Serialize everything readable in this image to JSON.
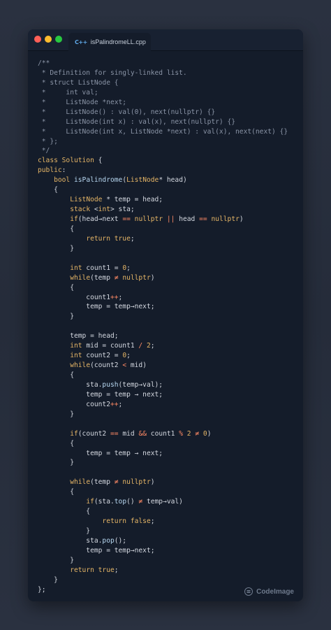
{
  "window": {
    "tab_icon": "C++",
    "tab_label": "isPalindromeLL.cpp"
  },
  "watermark": {
    "label": "CodeImage"
  },
  "colors": {
    "comment": "#8a94a6",
    "keyword": "#e5b566",
    "function": "#b7d7f0",
    "text": "#d4d8e0",
    "operator": "#ff8a65"
  },
  "code_lines": [
    [
      [
        "cm",
        "/**"
      ]
    ],
    [
      [
        "cm",
        " * Definition for singly-linked list."
      ]
    ],
    [
      [
        "cm",
        " * struct ListNode {"
      ]
    ],
    [
      [
        "cm",
        " *     int val;"
      ]
    ],
    [
      [
        "cm",
        " *     ListNode *next;"
      ]
    ],
    [
      [
        "cm",
        " *     ListNode() : val(0), next(nullptr) {}"
      ]
    ],
    [
      [
        "cm",
        " *     ListNode(int x) : val(x), next(nullptr) {}"
      ]
    ],
    [
      [
        "cm",
        " *     ListNode(int x, ListNode *next) : val(x), next(next) {}"
      ]
    ],
    [
      [
        "cm",
        " * };"
      ]
    ],
    [
      [
        "cm",
        " */"
      ]
    ],
    [
      [
        "kw",
        "class "
      ],
      [
        "ty",
        "Solution"
      ],
      [
        "tx",
        " {"
      ]
    ],
    [
      [
        "kw",
        "public"
      ],
      [
        "tx",
        ":"
      ]
    ],
    [
      [
        "tx",
        "    "
      ],
      [
        "kw",
        "bool "
      ],
      [
        "fn",
        "isPalindrome"
      ],
      [
        "tx",
        "("
      ],
      [
        "ty",
        "ListNode"
      ],
      [
        "tx",
        "* head)"
      ]
    ],
    [
      [
        "tx",
        "    {"
      ]
    ],
    [
      [
        "tx",
        "        "
      ],
      [
        "ty",
        "ListNode"
      ],
      [
        "tx",
        " * temp = head;"
      ]
    ],
    [
      [
        "tx",
        "        "
      ],
      [
        "ty",
        "stack"
      ],
      [
        "tx",
        " <"
      ],
      [
        "kw",
        "int"
      ],
      [
        "tx",
        "> sta;"
      ]
    ],
    [
      [
        "tx",
        "        "
      ],
      [
        "kw",
        "if"
      ],
      [
        "tx",
        "(head→next "
      ],
      [
        "op",
        "=="
      ],
      [
        "tx",
        " "
      ],
      [
        "kw",
        "nullptr"
      ],
      [
        "tx",
        " "
      ],
      [
        "op",
        "||"
      ],
      [
        "tx",
        " head "
      ],
      [
        "op",
        "=="
      ],
      [
        "tx",
        " "
      ],
      [
        "kw",
        "nullptr"
      ],
      [
        "tx",
        ")"
      ]
    ],
    [
      [
        "tx",
        "        {"
      ]
    ],
    [
      [
        "tx",
        "            "
      ],
      [
        "kw",
        "return "
      ],
      [
        "kw",
        "true"
      ],
      [
        "tx",
        ";"
      ]
    ],
    [
      [
        "tx",
        "        }"
      ]
    ],
    [
      [
        "tx",
        ""
      ]
    ],
    [
      [
        "tx",
        "        "
      ],
      [
        "kw",
        "int"
      ],
      [
        "tx",
        " count1 = "
      ],
      [
        "nm",
        "0"
      ],
      [
        "tx",
        ";"
      ]
    ],
    [
      [
        "tx",
        "        "
      ],
      [
        "kw",
        "while"
      ],
      [
        "tx",
        "(temp "
      ],
      [
        "op",
        "≠"
      ],
      [
        "tx",
        " "
      ],
      [
        "kw",
        "nullptr"
      ],
      [
        "tx",
        ")"
      ]
    ],
    [
      [
        "tx",
        "        {"
      ]
    ],
    [
      [
        "tx",
        "            count1"
      ],
      [
        "op",
        "++"
      ],
      [
        "tx",
        ";"
      ]
    ],
    [
      [
        "tx",
        "            temp = temp→next;"
      ]
    ],
    [
      [
        "tx",
        "        }"
      ]
    ],
    [
      [
        "tx",
        ""
      ]
    ],
    [
      [
        "tx",
        "        temp = head;"
      ]
    ],
    [
      [
        "tx",
        "        "
      ],
      [
        "kw",
        "int"
      ],
      [
        "tx",
        " mid = count1 "
      ],
      [
        "op",
        "/"
      ],
      [
        "tx",
        " "
      ],
      [
        "nm",
        "2"
      ],
      [
        "tx",
        ";"
      ]
    ],
    [
      [
        "tx",
        "        "
      ],
      [
        "kw",
        "int"
      ],
      [
        "tx",
        " count2 = "
      ],
      [
        "nm",
        "0"
      ],
      [
        "tx",
        ";"
      ]
    ],
    [
      [
        "tx",
        "        "
      ],
      [
        "kw",
        "while"
      ],
      [
        "tx",
        "(count2 "
      ],
      [
        "op",
        "<"
      ],
      [
        "tx",
        " mid)"
      ]
    ],
    [
      [
        "tx",
        "        {"
      ]
    ],
    [
      [
        "tx",
        "            sta."
      ],
      [
        "fn",
        "push"
      ],
      [
        "tx",
        "(temp→val);"
      ]
    ],
    [
      [
        "tx",
        "            temp = temp → next;"
      ]
    ],
    [
      [
        "tx",
        "            count2"
      ],
      [
        "op",
        "++"
      ],
      [
        "tx",
        ";"
      ]
    ],
    [
      [
        "tx",
        "        }"
      ]
    ],
    [
      [
        "tx",
        ""
      ]
    ],
    [
      [
        "tx",
        "        "
      ],
      [
        "kw",
        "if"
      ],
      [
        "tx",
        "(count2 "
      ],
      [
        "op",
        "=="
      ],
      [
        "tx",
        " mid "
      ],
      [
        "op",
        "&&"
      ],
      [
        "tx",
        " count1 "
      ],
      [
        "op",
        "%"
      ],
      [
        "tx",
        " "
      ],
      [
        "nm",
        "2"
      ],
      [
        "tx",
        " "
      ],
      [
        "op",
        "≠"
      ],
      [
        "tx",
        " "
      ],
      [
        "nm",
        "0"
      ],
      [
        "tx",
        ")"
      ]
    ],
    [
      [
        "tx",
        "        {"
      ]
    ],
    [
      [
        "tx",
        "            temp = temp → next;"
      ]
    ],
    [
      [
        "tx",
        "        }"
      ]
    ],
    [
      [
        "tx",
        ""
      ]
    ],
    [
      [
        "tx",
        "        "
      ],
      [
        "kw",
        "while"
      ],
      [
        "tx",
        "(temp "
      ],
      [
        "op",
        "≠"
      ],
      [
        "tx",
        " "
      ],
      [
        "kw",
        "nullptr"
      ],
      [
        "tx",
        ")"
      ]
    ],
    [
      [
        "tx",
        "        {"
      ]
    ],
    [
      [
        "tx",
        "            "
      ],
      [
        "kw",
        "if"
      ],
      [
        "tx",
        "(sta."
      ],
      [
        "fn",
        "top"
      ],
      [
        "tx",
        "() "
      ],
      [
        "op",
        "≠"
      ],
      [
        "tx",
        " temp→val)"
      ]
    ],
    [
      [
        "tx",
        "            {"
      ]
    ],
    [
      [
        "tx",
        "                "
      ],
      [
        "kw",
        "return "
      ],
      [
        "kw",
        "false"
      ],
      [
        "tx",
        ";"
      ]
    ],
    [
      [
        "tx",
        "            }"
      ]
    ],
    [
      [
        "tx",
        "            sta."
      ],
      [
        "fn",
        "pop"
      ],
      [
        "tx",
        "();"
      ]
    ],
    [
      [
        "tx",
        "            temp = temp→next;"
      ]
    ],
    [
      [
        "tx",
        "        }"
      ]
    ],
    [
      [
        "tx",
        "        "
      ],
      [
        "kw",
        "return "
      ],
      [
        "kw",
        "true"
      ],
      [
        "tx",
        ";"
      ]
    ],
    [
      [
        "tx",
        "    }"
      ]
    ],
    [
      [
        "tx",
        "};"
      ]
    ]
  ]
}
